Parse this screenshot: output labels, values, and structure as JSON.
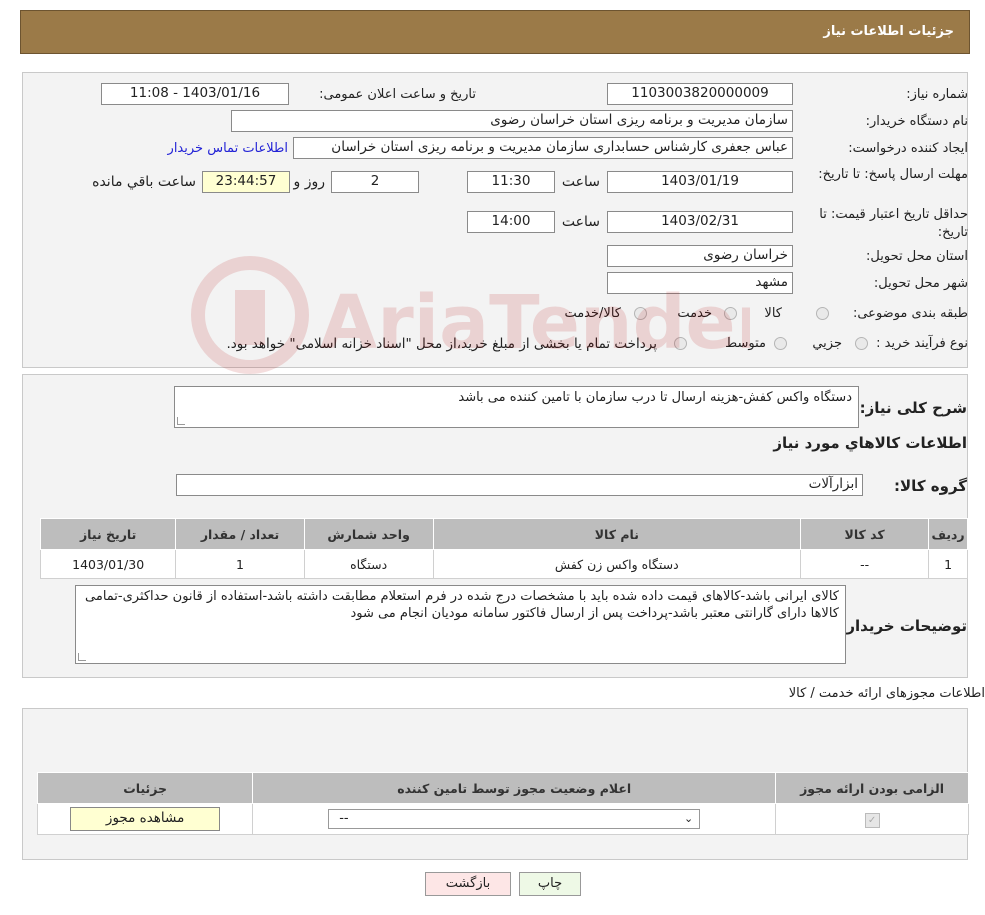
{
  "header": {
    "title": "جزئیات اطلاعات نیاز"
  },
  "form": {
    "need_number_label": "شماره نیاز:",
    "need_number": "1103003820000009",
    "announce_label": "تاریخ و ساعت اعلان عمومی:",
    "announce_value": "1403/01/16 - 11:08",
    "buyer_org_label": "نام دستگاه خریدار:",
    "buyer_org": "سازمان مدیریت و برنامه ریزی استان خراسان رضوی",
    "requester_label": "ایجاد کننده درخواست:",
    "requester": "عباس جعفری کارشناس حسابداری سازمان مدیریت و برنامه ریزی استان خراسان",
    "contact_link": "اطلاعات تماس خریدار",
    "deadline_label": "مهلت ارسال پاسخ: تا تاریخ:",
    "deadline_date": "1403/01/19",
    "hour_label": "ساعت",
    "deadline_time": "11:30",
    "days_value": "2",
    "days_label": "روز و",
    "remaining_time": "23:44:57",
    "remaining_label": "ساعت باقي مانده",
    "validity_label": "حداقل تاریخ اعتبار قیمت: تا تاریخ:",
    "validity_date": "1403/02/31",
    "validity_time": "14:00",
    "province_label": "استان محل تحویل:",
    "province": "خراسان رضوی",
    "city_label": "شهر محل تحویل:",
    "city": "مشهد",
    "category_label": "طبقه بندی موضوعی:",
    "category_options": [
      "کالا",
      "خدمت",
      "کالا/خدمت"
    ],
    "process_label": "نوع فرآیند خرید :",
    "process_options": [
      "جزیي",
      "متوسط"
    ],
    "process_note": "پرداخت تمام یا بخشی از مبلغ خرید،از محل \"اسناد خزانه اسلامی\" خواهد بود."
  },
  "need": {
    "summary_label": "شرح کلی نیاز:",
    "summary": "دستگاه واکس کفش-هزینه ارسال تا درب سازمان با تامین کننده می باشد",
    "goods_info_title": "اطلاعات کالاهاي مورد نياز",
    "goods_group_label": "گروه کالا:",
    "goods_group": "ابزارآلات",
    "table_headers": [
      "ردیف",
      "کد کالا",
      "نام کالا",
      "واحد شمارش",
      "تعداد / مقدار",
      "تاریخ نیاز"
    ],
    "table_rows": [
      [
        "1",
        "--",
        "دستگاه واکس زن کفش",
        "دستگاه",
        "1",
        "1403/01/30"
      ]
    ],
    "buyer_notes_label": "توضیحات خریدار:",
    "buyer_notes": "کالای ایرانی باشد-کالاهای قیمت داده شده باید با مشخصات درج شده در فرم استعلام مطابقت داشته باشد-استفاده از قانون حداکثری-تمامی کالاها دارای گارانتی معتبر باشد-پرداخت پس از ارسال فاکتور سامانه مودیان انجام می شود"
  },
  "permits": {
    "title": "اطلاعات مجوزهای ارائه خدمت / کالا",
    "headers": [
      "الزامی بودن ارائه مجوز",
      "اعلام وضعیت مجوز توسط تامین کننده",
      "جزئیات"
    ],
    "select_value": "--",
    "view_button": "مشاهده مجوز"
  },
  "actions": {
    "print": "چاپ",
    "back": "بازگشت"
  },
  "watermark": {
    "text": "AriaTender.neT",
    "color": "#b20000"
  }
}
